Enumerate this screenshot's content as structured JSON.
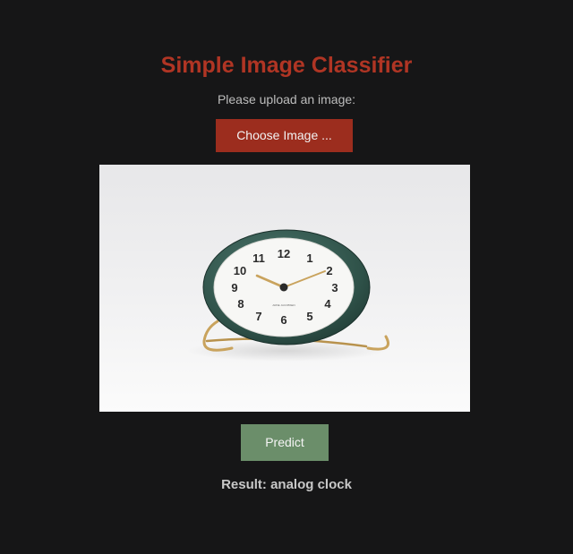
{
  "app": {
    "title": "Simple Image Classifier",
    "instruction": "Please upload an image:",
    "choose_button_label": "Choose Image ...",
    "predict_button_label": "Predict",
    "result_text": "Result: analog clock"
  },
  "preview_image": {
    "subject_icon": "analog-clock-icon",
    "clock_face_numbers": [
      "12",
      "1",
      "2",
      "3",
      "4",
      "5",
      "6",
      "7",
      "8",
      "9",
      "10",
      "11"
    ],
    "brand_mark": "ARNE JACOBSEN"
  },
  "colors": {
    "background": "#161617",
    "title": "#b03524",
    "choose_button": "#9c2d1e",
    "predict_button": "#6b8e6a",
    "clock_case": "#355a52",
    "clock_stand": "#c9a35d"
  }
}
